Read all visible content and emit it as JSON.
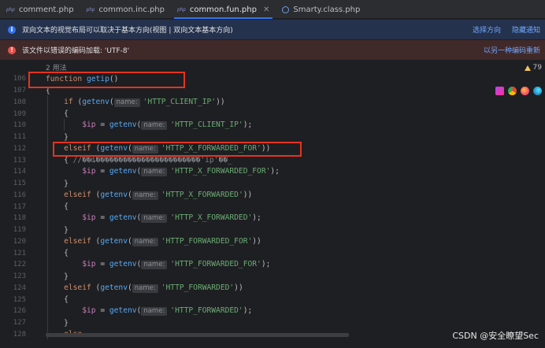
{
  "tabs": [
    {
      "label": "comment.php",
      "type": "php",
      "active": false
    },
    {
      "label": "common.inc.php",
      "type": "php",
      "active": false
    },
    {
      "label": "common.fun.php",
      "type": "php",
      "active": true
    },
    {
      "label": "Smarty.class.php",
      "type": "class",
      "active": false
    }
  ],
  "tab_type_label": "php",
  "info_bar": {
    "message": "双向文本的视觉布局可以取决于基本方向(视图 | 双向文本基本方向)",
    "actions": [
      "选择方向",
      "隐藏通知"
    ]
  },
  "error_bar": {
    "message": "该文件以错误的编码加载: 'UTF-8'",
    "actions": [
      "以另一种编码重新"
    ]
  },
  "editor": {
    "usages": "2 用法",
    "warning_count": "79",
    "lines": [
      {
        "n": "106",
        "tokens": [
          [
            "kw",
            "function "
          ],
          [
            "fn",
            "getip"
          ],
          [
            "plain",
            "()"
          ]
        ]
      },
      {
        "n": "107",
        "tokens": [
          [
            "plain",
            "{"
          ]
        ]
      },
      {
        "n": "108",
        "tokens": [
          [
            "plain",
            "    "
          ],
          [
            "kw",
            "if "
          ],
          [
            "plain",
            "("
          ],
          [
            "fn",
            "getenv"
          ],
          [
            "plain",
            "("
          ],
          [
            "hint",
            "name:"
          ],
          [
            "str",
            "'HTTP_CLIENT_IP'"
          ],
          [
            "plain",
            "))"
          ]
        ]
      },
      {
        "n": "109",
        "tokens": [
          [
            "plain",
            "    {"
          ]
        ]
      },
      {
        "n": "110",
        "tokens": [
          [
            "plain",
            "        "
          ],
          [
            "var",
            "$ip"
          ],
          [
            "plain",
            " = "
          ],
          [
            "fn",
            "getenv"
          ],
          [
            "plain",
            "("
          ],
          [
            "hint",
            "name:"
          ],
          [
            "str",
            "'HTTP_CLIENT_IP'"
          ],
          [
            "plain",
            ");"
          ]
        ]
      },
      {
        "n": "111",
        "tokens": [
          [
            "plain",
            "    }"
          ]
        ]
      },
      {
        "n": "112",
        "tokens": [
          [
            "plain",
            "    "
          ],
          [
            "kw",
            "elseif "
          ],
          [
            "plain",
            "("
          ],
          [
            "fn",
            "getenv"
          ],
          [
            "plain",
            "("
          ],
          [
            "hint",
            "name:"
          ],
          [
            "str",
            "'HTTP_X_FORWARDED_FOR'"
          ],
          [
            "plain",
            "))"
          ]
        ]
      },
      {
        "n": "113",
        "tokens": [
          [
            "plain",
            "    { "
          ],
          [
            "cmt",
            "//��ȡ�����������������������'ip'��_"
          ]
        ]
      },
      {
        "n": "114",
        "tokens": [
          [
            "plain",
            "        "
          ],
          [
            "var",
            "$ip"
          ],
          [
            "plain",
            " = "
          ],
          [
            "fn",
            "getenv"
          ],
          [
            "plain",
            "("
          ],
          [
            "hint",
            "name:"
          ],
          [
            "str",
            "'HTTP_X_FORWARDED_FOR'"
          ],
          [
            "plain",
            ");"
          ]
        ]
      },
      {
        "n": "115",
        "tokens": [
          [
            "plain",
            "    }"
          ]
        ]
      },
      {
        "n": "116",
        "tokens": [
          [
            "plain",
            "    "
          ],
          [
            "kw",
            "elseif "
          ],
          [
            "plain",
            "("
          ],
          [
            "fn",
            "getenv"
          ],
          [
            "plain",
            "("
          ],
          [
            "hint",
            "name:"
          ],
          [
            "str",
            "'HTTP_X_FORWARDED'"
          ],
          [
            "plain",
            "))"
          ]
        ]
      },
      {
        "n": "117",
        "tokens": [
          [
            "plain",
            "    {"
          ]
        ]
      },
      {
        "n": "118",
        "tokens": [
          [
            "plain",
            "        "
          ],
          [
            "var",
            "$ip"
          ],
          [
            "plain",
            " = "
          ],
          [
            "fn",
            "getenv"
          ],
          [
            "plain",
            "("
          ],
          [
            "hint",
            "name:"
          ],
          [
            "str",
            "'HTTP_X_FORWARDED'"
          ],
          [
            "plain",
            ");"
          ]
        ]
      },
      {
        "n": "119",
        "tokens": [
          [
            "plain",
            "    }"
          ]
        ]
      },
      {
        "n": "120",
        "tokens": [
          [
            "plain",
            "    "
          ],
          [
            "kw",
            "elseif "
          ],
          [
            "plain",
            "("
          ],
          [
            "fn",
            "getenv"
          ],
          [
            "plain",
            "("
          ],
          [
            "hint",
            "name:"
          ],
          [
            "str",
            "'HTTP_FORWARDED_FOR'"
          ],
          [
            "plain",
            "))"
          ]
        ]
      },
      {
        "n": "121",
        "tokens": [
          [
            "plain",
            "    {"
          ]
        ]
      },
      {
        "n": "122",
        "tokens": [
          [
            "plain",
            "        "
          ],
          [
            "var",
            "$ip"
          ],
          [
            "plain",
            " = "
          ],
          [
            "fn",
            "getenv"
          ],
          [
            "plain",
            "("
          ],
          [
            "hint",
            "name:"
          ],
          [
            "str",
            "'HTTP_FORWARDED_FOR'"
          ],
          [
            "plain",
            ");"
          ]
        ]
      },
      {
        "n": "123",
        "tokens": [
          [
            "plain",
            "    }"
          ]
        ]
      },
      {
        "n": "124",
        "tokens": [
          [
            "plain",
            "    "
          ],
          [
            "kw",
            "elseif "
          ],
          [
            "plain",
            "("
          ],
          [
            "fn",
            "getenv"
          ],
          [
            "plain",
            "("
          ],
          [
            "hint",
            "name:"
          ],
          [
            "str",
            "'HTTP_FORWARDED'"
          ],
          [
            "plain",
            "))"
          ]
        ]
      },
      {
        "n": "125",
        "tokens": [
          [
            "plain",
            "    {"
          ]
        ]
      },
      {
        "n": "126",
        "tokens": [
          [
            "plain",
            "        "
          ],
          [
            "var",
            "$ip"
          ],
          [
            "plain",
            " = "
          ],
          [
            "fn",
            "getenv"
          ],
          [
            "plain",
            "("
          ],
          [
            "hint",
            "name:"
          ],
          [
            "str",
            "'HTTP_FORWARDED'"
          ],
          [
            "plain",
            ");"
          ]
        ]
      },
      {
        "n": "127",
        "tokens": [
          [
            "plain",
            "    }"
          ]
        ]
      },
      {
        "n": "128",
        "tokens": [
          [
            "plain",
            "    "
          ],
          [
            "kw",
            "else"
          ]
        ]
      }
    ]
  },
  "browser_icons": [
    "phpstorm-icon",
    "chrome-icon",
    "firefox-icon",
    "edge-icon"
  ],
  "colors": {
    "accent": "#3574f0",
    "highlight_box": "#e53420"
  },
  "watermark": "CSDN @安全瞭望Sec"
}
